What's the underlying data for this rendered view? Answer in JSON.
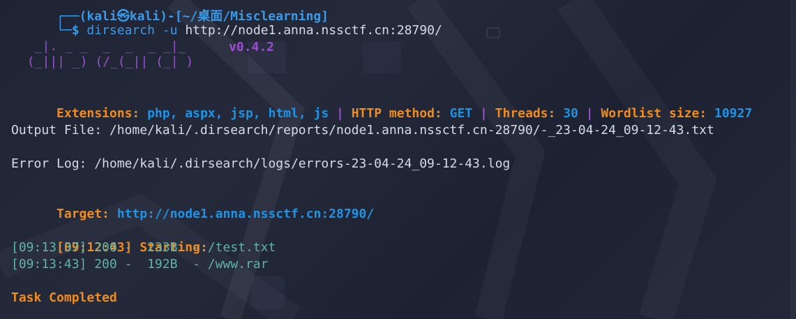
{
  "prompt": {
    "partial_top": "(kali㉿kali)-[~/桌面/Misclearning]",
    "corner_glyph": "└─",
    "dollar": "$",
    "command": "dirsearch",
    "flag": "-u",
    "url": "http://node1.anna.nssctf.cn:28790/"
  },
  "banner": {
    "logo_line1": "  _|. _ _  _  _  _ _|_",
    "logo_line2": " (_||| _) (/_(_|| (_| )",
    "version": "v0.4.2"
  },
  "config": {
    "extensions_label": "Extensions:",
    "extensions_value": "php, aspx, jsp, html, js",
    "sep1": "|",
    "method_label": "HTTP method:",
    "method_value": "GET",
    "sep2": "|",
    "threads_label": "Threads:",
    "threads_value": "30",
    "sep3": "|",
    "wordlist_label": "Wordlist size:",
    "wordlist_value": "10927"
  },
  "output_file": "Output File: /home/kali/.dirsearch/reports/node1.anna.nssctf.cn-28790/-_23-04-24_09-12-43.txt",
  "error_log": "Error Log: /home/kali/.dirsearch/logs/errors-23-04-24_09-12-43.log",
  "target": {
    "label": "Target:",
    "value": "http://node1.anna.nssctf.cn:28790/"
  },
  "scan": {
    "start_time": "[09:12:43]",
    "start_label": "Starting:",
    "results": [
      {
        "line": "[09:13:37] 200 -  233B  - /test.txt"
      },
      {
        "line": "[09:13:43] 200 -  192B  - /www.rar"
      }
    ]
  },
  "footer": {
    "completed": "Task Completed"
  },
  "colors": {
    "background": "#1f2434",
    "orange": "#f08c1f",
    "blue": "#1e93e6",
    "purple": "#9a4fd0",
    "teal": "#5fb3a9",
    "text": "#d6dbe5"
  }
}
